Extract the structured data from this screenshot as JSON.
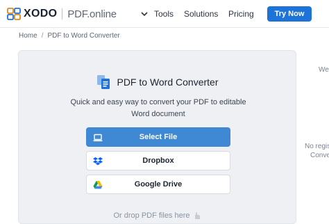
{
  "header": {
    "brand": "XODO",
    "product": "PDF.online",
    "nav": {
      "tools": "Tools",
      "solutions": "Solutions",
      "pricing": "Pricing"
    },
    "cta": "Try Now"
  },
  "breadcrumb": {
    "home": "Home",
    "separator": "/",
    "current": "PDF to Word Converter"
  },
  "card": {
    "title": "PDF to Word Converter",
    "description": "Quick and easy way to convert your PDF to editable Word document",
    "select_file": "Select File",
    "dropbox": "Dropbox",
    "google_drive": "Google Drive",
    "drop_hint": "Or drop PDF files here"
  },
  "right_panel": {
    "line1": "We",
    "line2": "No regis",
    "line3": "Conve"
  },
  "colors": {
    "accent": "#1e73d8",
    "select_button": "#3f88d4",
    "card_background": "#eef0f3",
    "dropbox_blue": "#0061fe"
  },
  "icons": {
    "logo": "xodo-logo-icon",
    "tools": "chevron-down-icon",
    "converter": "pdf-to-word-icon",
    "select_file": "laptop-icon",
    "dropbox": "dropbox-icon",
    "google_drive": "google-drive-icon",
    "drop_hint": "hand-icon"
  }
}
